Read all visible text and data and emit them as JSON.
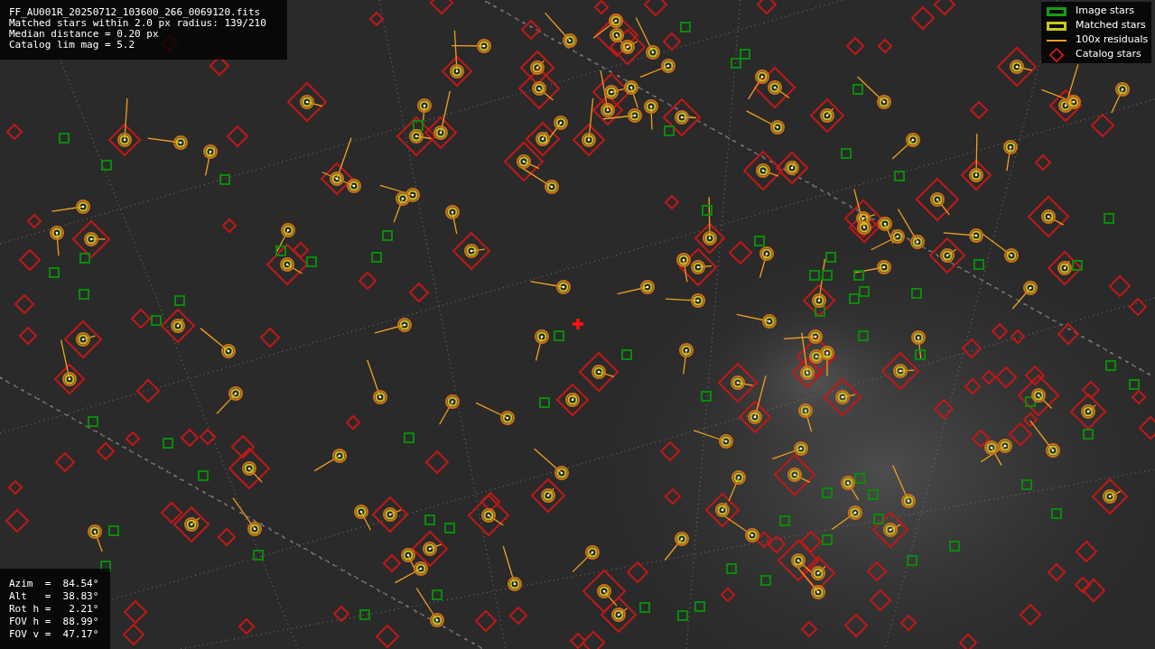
{
  "header": {
    "lines": [
      "FF_AU001R_20250712_103600_266_0069120.fits",
      "Matched stars within 2.0 px radius: 139/210",
      "Median distance = 0.20 px",
      "Catalog lim mag = 5.2"
    ]
  },
  "legend": {
    "items": [
      {
        "label": "Image stars",
        "kind": "image"
      },
      {
        "label": "Matched stars",
        "kind": "matched"
      },
      {
        "label": "100x residuals",
        "kind": "residual"
      },
      {
        "label": "Catalog stars",
        "kind": "catalog"
      }
    ]
  },
  "pointing": {
    "lines": [
      "Azim  =  84.54°",
      "Alt   =  38.83°",
      "Rot h =   2.21°",
      "FOV h =  88.99°",
      "FOV v =  47.17°"
    ]
  }
}
